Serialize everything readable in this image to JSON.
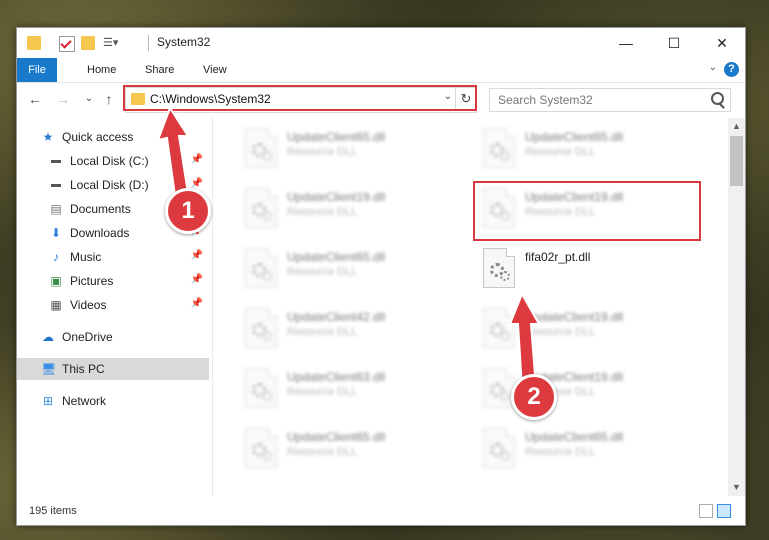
{
  "window": {
    "title": "System32",
    "controls": {
      "minimize": "—",
      "maximize": "☐",
      "close": "✕"
    }
  },
  "ribbon": {
    "tabs": [
      {
        "label": "File"
      },
      {
        "label": "Home"
      },
      {
        "label": "Share"
      },
      {
        "label": "View"
      }
    ],
    "help": "?"
  },
  "nav": {
    "back": "←",
    "forward": "→",
    "recent": "⌄",
    "up": "↑",
    "address": "C:\\Windows\\System32",
    "search_placeholder": "Search System32"
  },
  "sidebar": {
    "items": [
      {
        "label": "Quick access",
        "icon": "star-icon",
        "pinned": false
      },
      {
        "label": "Local Disk (C:)",
        "icon": "drive-icon",
        "pinned": true
      },
      {
        "label": "Local Disk (D:)",
        "icon": "drive-icon",
        "pinned": true
      },
      {
        "label": "Documents",
        "icon": "documents-icon",
        "pinned": true
      },
      {
        "label": "Downloads",
        "icon": "download-icon",
        "pinned": true
      },
      {
        "label": "Music",
        "icon": "music-icon",
        "pinned": true
      },
      {
        "label": "Pictures",
        "icon": "pictures-icon",
        "pinned": true
      },
      {
        "label": "Videos",
        "icon": "videos-icon",
        "pinned": true
      },
      {
        "label": "OneDrive",
        "icon": "cloud-icon",
        "pinned": false
      },
      {
        "label": "This PC",
        "icon": "computer-icon",
        "pinned": false
      },
      {
        "label": "Network",
        "icon": "network-icon",
        "pinned": false
      }
    ]
  },
  "files": {
    "left": [
      {
        "name": "UpdateClient65.dll",
        "type": "Resource DLL"
      },
      {
        "name": "UpdateClient19.dll",
        "type": "Resource DLL"
      },
      {
        "name": "UpdateClient65.dll",
        "type": "Resource DLL"
      },
      {
        "name": "UpdateClient42.dll",
        "type": "Resource DLL"
      },
      {
        "name": "UpdateClient63.dll",
        "type": "Resource DLL"
      },
      {
        "name": "UpdateClient65.dll",
        "type": "Resource DLL"
      }
    ],
    "right": [
      {
        "name": "UpdateClient65.dll",
        "type": "Resource DLL"
      },
      {
        "name": "UpdateClient19.dll",
        "type": "Resource DLL"
      },
      {
        "name": "fifa02r_pt.dll",
        "type": ""
      },
      {
        "name": "UpdateClient19.dll",
        "type": "Resource DLL"
      },
      {
        "name": "UpdateClient19.dll",
        "type": "Resource DLL"
      },
      {
        "name": "UpdateClient65.dll",
        "type": "Resource DLL"
      }
    ]
  },
  "status": {
    "items_count": "195 items"
  },
  "callouts": {
    "one": "1",
    "two": "2"
  },
  "colors": {
    "accent": "#1979ca",
    "highlight": "#d9393e"
  }
}
